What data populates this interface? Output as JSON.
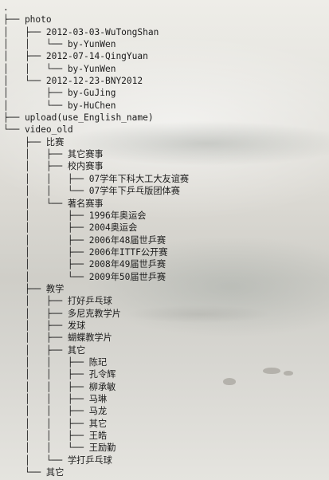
{
  "tree": {
    "lines": [
      ".",
      "├── photo",
      "│   ├── 2012-03-03-WuTongShan",
      "│   │   └── by-YunWen",
      "│   ├── 2012-07-14-QingYuan",
      "│   │   └── by-YunWen",
      "│   └── 2012-12-23-BNY2012",
      "│       ├── by-GuJing",
      "│       └── by-HuChen",
      "├── upload(use_English_name)",
      "└── video_old",
      "    ├── 比赛",
      "    │   ├── 其它赛事",
      "    │   ├── 校内赛事",
      "    │   │   ├── 07学年下科大工大友谊赛",
      "    │   │   └── 07学年下乒乓版团体赛",
      "    │   └── 著名赛事",
      "    │       ├── 1996年奥运会",
      "    │       ├── 2004奥运会",
      "    │       ├── 2006年48届世乒赛",
      "    │       ├── 2006年ITTF公开赛",
      "    │       ├── 2008年49届世乒赛",
      "    │       └── 2009年50届世乒赛",
      "    ├── 教学",
      "    │   ├── 打好乒乓球",
      "    │   ├── 多尼克教学片",
      "    │   ├── 发球",
      "    │   ├── 蝴蝶教学片",
      "    │   ├── 其它",
      "    │   │   ├── 陈玘",
      "    │   │   ├── 孔令辉",
      "    │   │   ├── 柳承敏",
      "    │   │   ├── 马琳",
      "    │   │   ├── 马龙",
      "    │   │   ├── 其它",
      "    │   │   ├── 王皓",
      "    │   │   └── 王励勤",
      "    │   └── 学打乒乓球",
      "    └── 其它"
    ]
  }
}
